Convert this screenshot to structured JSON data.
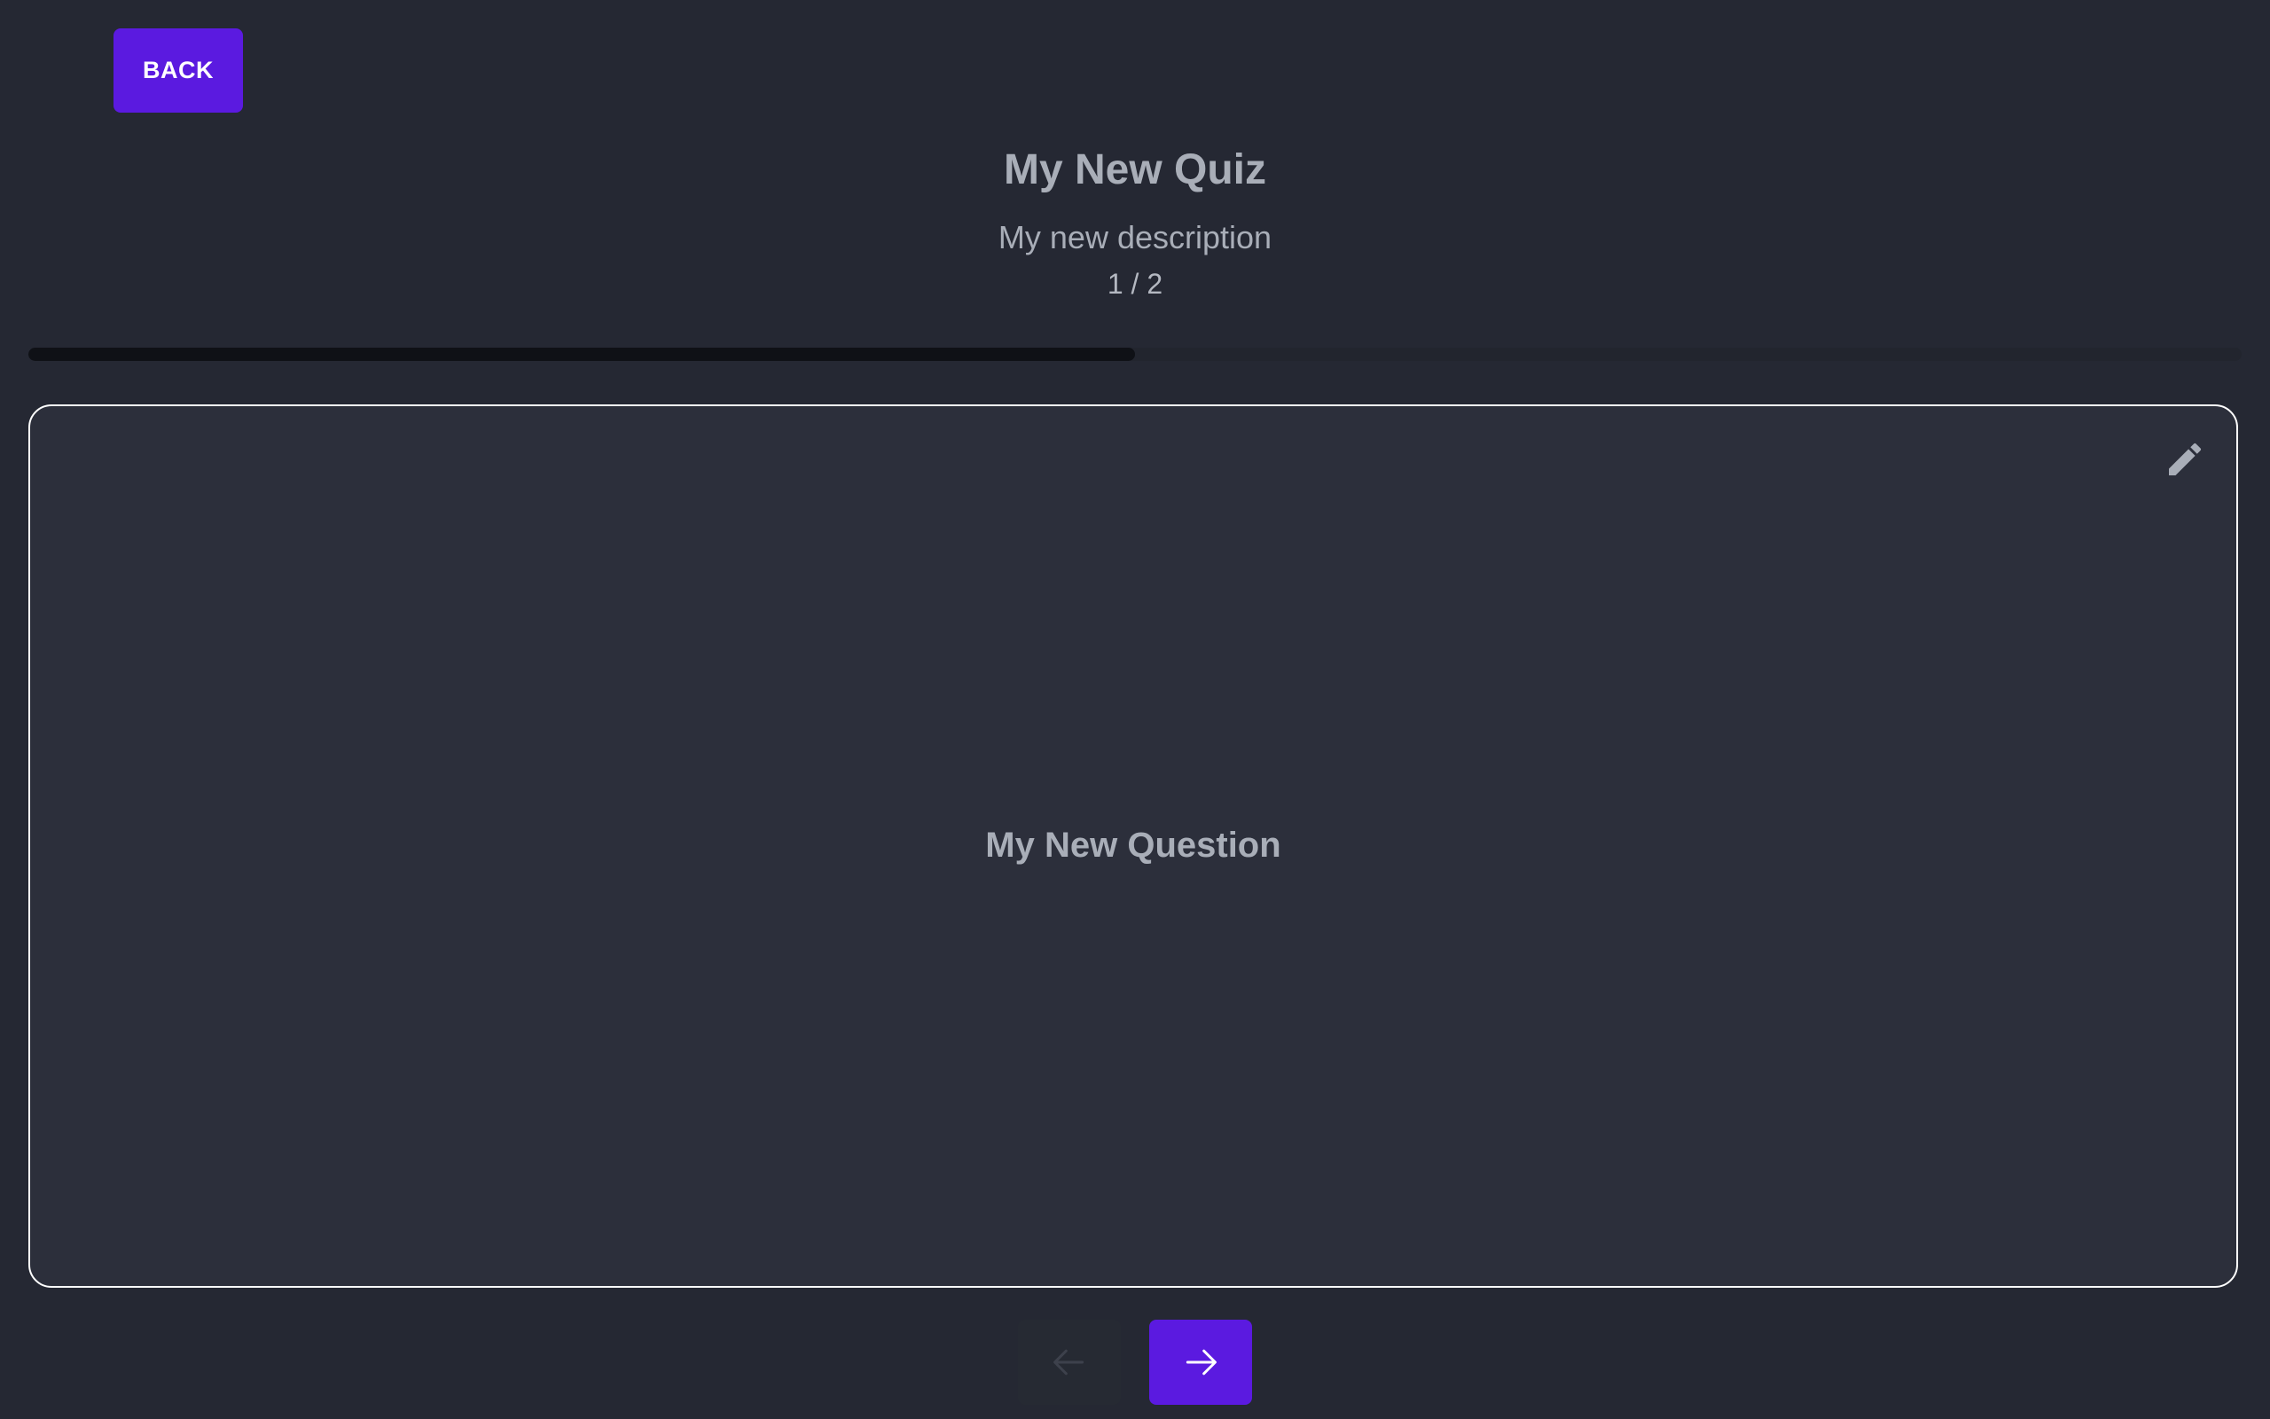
{
  "back_button": {
    "label": "BACK"
  },
  "quiz": {
    "title": "My New Quiz",
    "description": "My new description",
    "counter": "1 / 2",
    "progress_fraction": 0.5
  },
  "question": {
    "text": "My New Question"
  },
  "icons": {
    "edit": "pencil-icon",
    "prev": "arrow-left-icon",
    "next": "arrow-right-icon"
  },
  "colors": {
    "accent": "#5b1ae0",
    "background": "#252833",
    "card": "#2c2f3b",
    "progress_fill": "#0f1116",
    "text_muted": "#a9aeb8"
  }
}
